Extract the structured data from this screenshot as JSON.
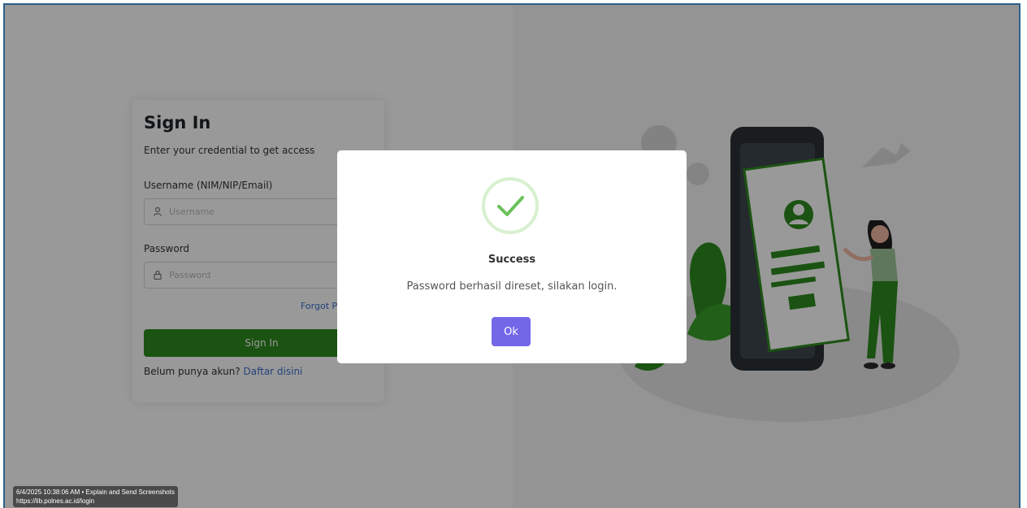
{
  "signin": {
    "title": "Sign In",
    "subtitle": "Enter your credential to get access",
    "username_label": "Username (NIM/NIP/Email)",
    "username_placeholder": "Username",
    "password_label": "Password",
    "password_placeholder": "Password",
    "forgot_label": "Forgot Pa",
    "button_label": "Sign In",
    "register_text": "Belum punya akun?",
    "register_link": "Daftar disini"
  },
  "modal": {
    "title": "Success",
    "message": "Password berhasil direset, silakan login.",
    "ok_label": "Ok"
  },
  "capture_tag": {
    "line1": "6/4/2025 10:38:06 AM • Explain and Send Screenshots",
    "line2": "https://lib.polnes.ac.id/login"
  },
  "colors": {
    "primary_green": "#2e8b1e",
    "link_blue": "#3b6fd1",
    "ok_purple": "#7367e8",
    "success_green": "#6ac259"
  }
}
